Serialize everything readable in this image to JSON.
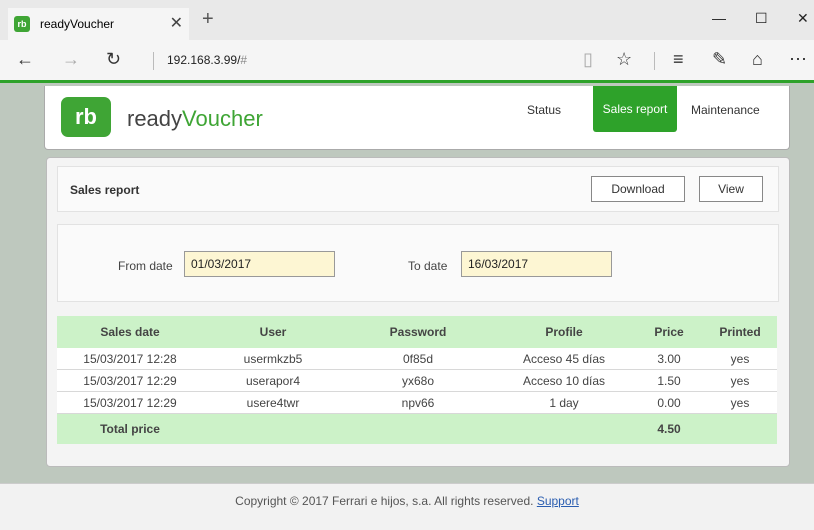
{
  "browser": {
    "tab_title": "readyVoucher",
    "favicon_text": "rb",
    "address": "192.168.3.99/",
    "address_hash": "#",
    "icons": [
      "back-arrow-icon",
      "forward-arrow-icon",
      "refresh-icon",
      "reading-view-icon",
      "favorite-star-icon",
      "hub-icon",
      "web-note-icon",
      "share-icon",
      "more-icon"
    ]
  },
  "header": {
    "logo_mark": "rb",
    "logo_text_1": "ready",
    "logo_text_2": "Voucher",
    "nav": {
      "status": "Status",
      "sales_report": "Sales report",
      "maintenance": "Maintenance"
    }
  },
  "toolbar": {
    "title": "Sales report",
    "download_label": "Download",
    "view_label": "View"
  },
  "filter": {
    "from_label": "From date",
    "from_value": "01/03/2017",
    "to_label": "To date",
    "to_value": "16/03/2017"
  },
  "table": {
    "headers": [
      "Sales date",
      "User",
      "Password",
      "Profile",
      "Price",
      "Printed"
    ],
    "rows": [
      [
        "15/03/2017 12:28",
        "usermkzb5",
        "0f85d",
        "Acceso 45 días",
        "3.00",
        "yes"
      ],
      [
        "15/03/2017 12:29",
        "userapor4",
        "yx68o",
        "Acceso 10 días",
        "1.50",
        "yes"
      ],
      [
        "15/03/2017 12:29",
        "usere4twr",
        "npv66",
        "1 day",
        "0.00",
        "yes"
      ]
    ],
    "total_label": "Total price",
    "total_value": "4.50"
  },
  "footer": {
    "copyright": "Copyright © 2017 Ferrari e hijos, s.a. All rights reserved.",
    "support": "Support"
  },
  "colors": {
    "brand_green": "#2ea22a",
    "table_header": "#ccf2c8",
    "date_input_bg": "#fdf6d3"
  }
}
